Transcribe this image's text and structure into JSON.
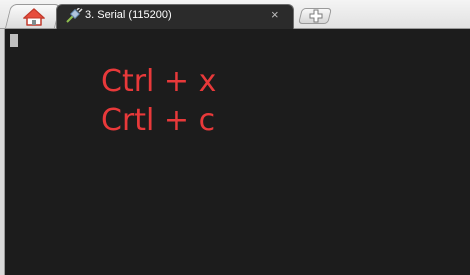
{
  "tabs": {
    "home": {
      "icon": "home-icon"
    },
    "active": {
      "icon": "serial-plug-icon",
      "title": "3. Serial (115200)",
      "close_label": "×"
    },
    "new_tab": {
      "icon": "new-tab-plus-icon"
    }
  },
  "terminal": {
    "lines": [
      "Ctrl + x",
      "Crtl + c"
    ],
    "annotation_color": "#e8393a",
    "background": "#1c1c1c"
  }
}
